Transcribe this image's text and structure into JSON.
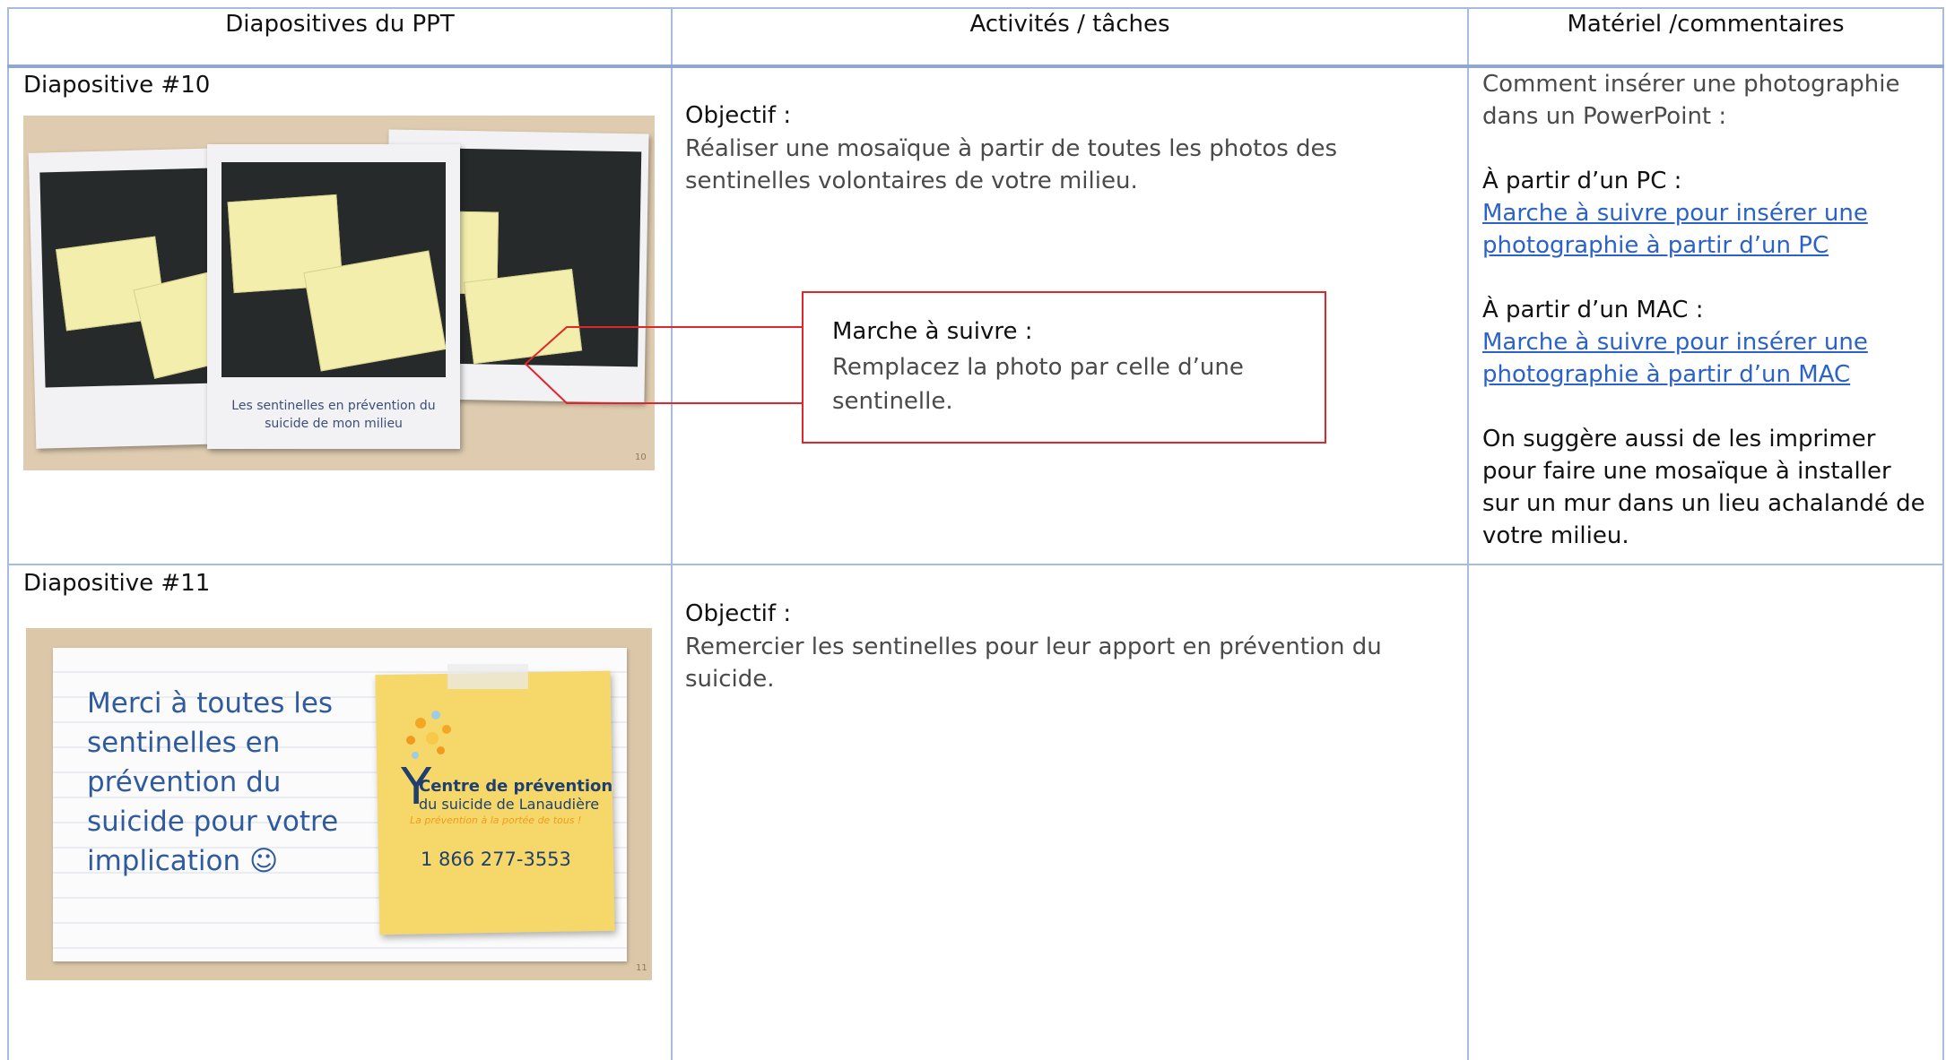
{
  "headers": {
    "col1": "Diapositives du PPT",
    "col2": "Activités / tâches",
    "col3": "Matériel /commentaires"
  },
  "row1": {
    "slide_label": "Diapositive #10",
    "slide_caption": "Les sentinelles en prévention du suicide de mon milieu",
    "slide_number": "10",
    "objective_label": "Objectif :",
    "objective_text": "Réaliser une mosaïque à partir de toutes les photos des sentinelles volontaires de votre milieu.",
    "callout_title": "Marche à suivre :",
    "callout_text": "Remplacez la photo par celle d’une sentinelle.",
    "material": {
      "intro": "Comment insérer une photographie dans un PowerPoint :",
      "pc_heading": "À partir d’un PC :",
      "pc_link": "Marche à suivre pour insérer une photographie à partir d’un PC",
      "mac_heading": "À partir d’un MAC :",
      "mac_link": " Marche à suivre pour insérer une photographie à partir d’un MAC",
      "note": "On suggère aussi de les imprimer pour faire une mosaïque à installer sur un mur dans un lieu achalandé de votre milieu."
    }
  },
  "row2": {
    "slide_label": "Diapositive #11",
    "slide_thanks": "Merci à toutes les sentinelles en prévention du suicide pour votre implication ☺",
    "org_name_1": "Centre de prévention",
    "org_name_2": "du suicide de Lanaudière",
    "org_tagline": "La prévention à la portée de tous !",
    "org_phone": "1 866 277-3553",
    "slide_number": "11",
    "objective_label": "Objectif :",
    "objective_text": "Remercier les sentinelles pour leur apport en prévention du suicide."
  },
  "colors": {
    "grid": "#a7bcdc",
    "link": "#2b62c7",
    "callout_border": "#e0262b",
    "thanks_text": "#2f5a9e",
    "sticky": "#f6d86a"
  }
}
